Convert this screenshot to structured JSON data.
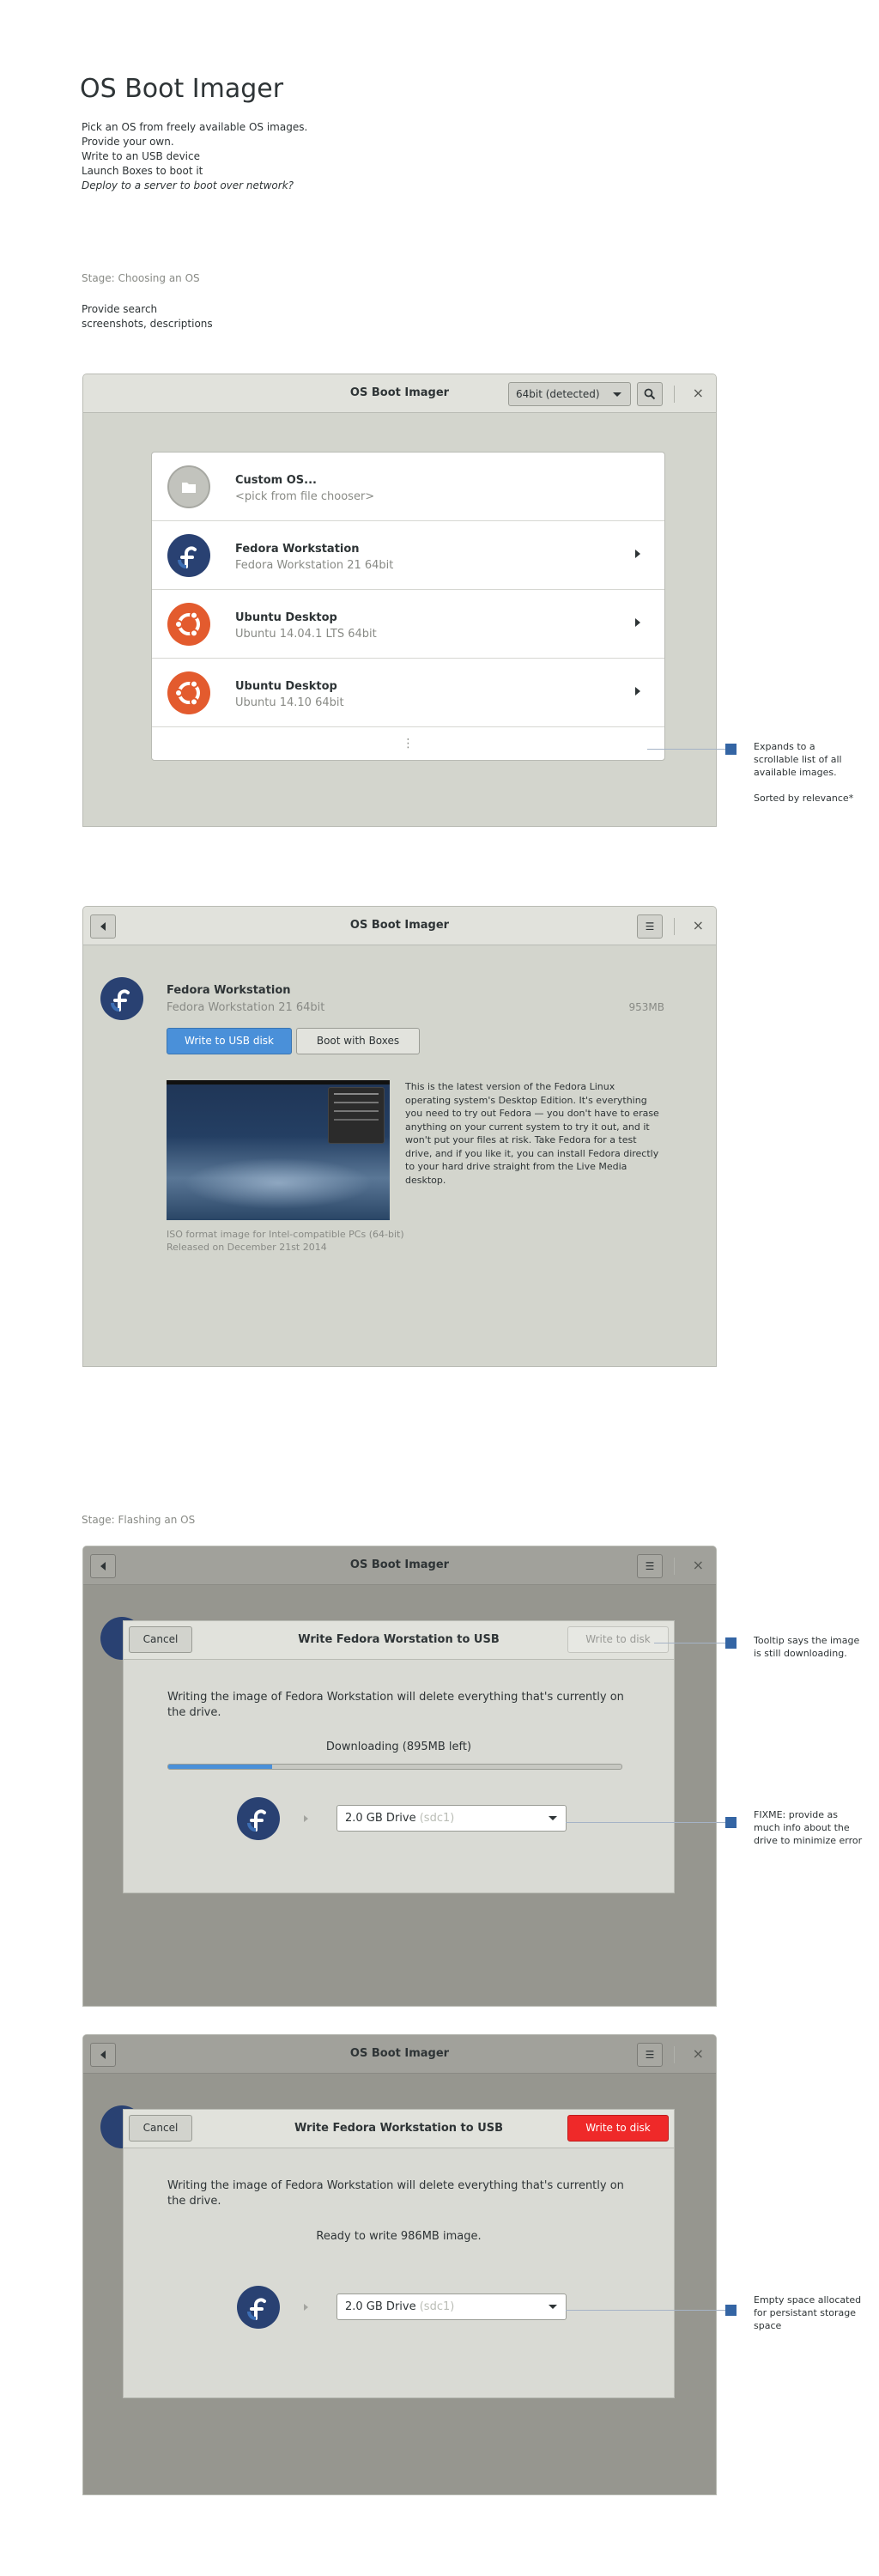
{
  "page": {
    "title": "OS Boot Imager",
    "intro_lines": [
      "Pick an OS from freely available OS images.",
      "Provide your own.",
      "Write to an USB device",
      "Launch Boxes to boot it"
    ],
    "intro_italic": "Deploy to a server to boot over network?",
    "stage_choosing": "Stage: Choosing an OS",
    "provide_line1": "Provide search",
    "provide_line2": "screenshots, descriptions",
    "stage_flashing": "Stage: Flashing an OS"
  },
  "window1": {
    "title": "OS Boot Imager",
    "arch_select": "64bit (detected)",
    "search_icon": "search-icon",
    "close_icon": "close-icon",
    "os_items": [
      {
        "name": "Custom OS...",
        "sub": "<pick from file chooser>",
        "icon": "folder-icon"
      },
      {
        "name": "Fedora Workstation",
        "sub": "Fedora Workstation 21 64bit",
        "icon": "fedora-icon"
      },
      {
        "name": "Ubuntu Desktop",
        "sub": "Ubuntu 14.04.1 LTS 64bit",
        "icon": "ubuntu-icon"
      },
      {
        "name": "Ubuntu Desktop",
        "sub": "Ubuntu 14.10 64bit",
        "icon": "ubuntu-icon"
      }
    ],
    "more_glyph": "⋮"
  },
  "annotations": {
    "list_note_1": "Expands to a",
    "list_note_2": "scrollable list of all",
    "list_note_3": "available images.",
    "list_note_4": "Sorted by relevance*",
    "tooltip_note_1": "Tooltip says the image",
    "tooltip_note_2": "is still downloading.",
    "fixme_note_1": "FIXME: provide as",
    "fixme_note_2": "much info about the",
    "fixme_note_3": "drive to minimize error",
    "empty_note_1": "Empty space allocated",
    "empty_note_2": "for persistant storage",
    "empty_note_3": "space"
  },
  "window2": {
    "title": "OS Boot Imager",
    "os_name": "Fedora Workstation",
    "os_sub": "Fedora Workstation 21 64bit",
    "size": "953MB",
    "write_button": "Write to USB disk",
    "boot_button": "Boot with Boxes",
    "description": "This is the latest version of the Fedora Linux operating system's Desktop Edition. It's everything you need to try out Fedora — you don't have to erase anything on your current system to try it out, and it won't put your files at risk. Take Fedora for a test drive, and if you like it, you can install Fedora directly to your hard drive straight from the Live Media desktop.",
    "meta_line1": "ISO format image for Intel-compatible PCs (64-bit)",
    "meta_line2": "Released on December 21st 2014"
  },
  "window3": {
    "title": "OS Boot Imager",
    "dialog_title": "Write Fedora Worstation to USB",
    "cancel": "Cancel",
    "write": "Write to disk",
    "warning": "Writing the image of Fedora Workstation will delete everything that's currently on the drive.",
    "status": "Downloading (895MB left)",
    "progress": 0.23,
    "drive": "2.0 GB Drive",
    "drive_dev": "(sdc1)"
  },
  "window4": {
    "title": "OS Boot Imager",
    "dialog_title": "Write Fedora Workstation to USB",
    "cancel": "Cancel",
    "write": "Write to disk",
    "warning": "Writing the image of Fedora Workstation will delete everything that's currently on the drive.",
    "status": "Ready to write 986MB image.",
    "drive": "2.0 GB Drive",
    "drive_dev": "(sdc1)"
  },
  "colors": {
    "accent_blue": "#4a90d9",
    "destructive_red": "#ef2929",
    "annotation_marker": "#3465a4",
    "fedora_blue": "#294172",
    "ubuntu_orange": "#e35b2e"
  }
}
